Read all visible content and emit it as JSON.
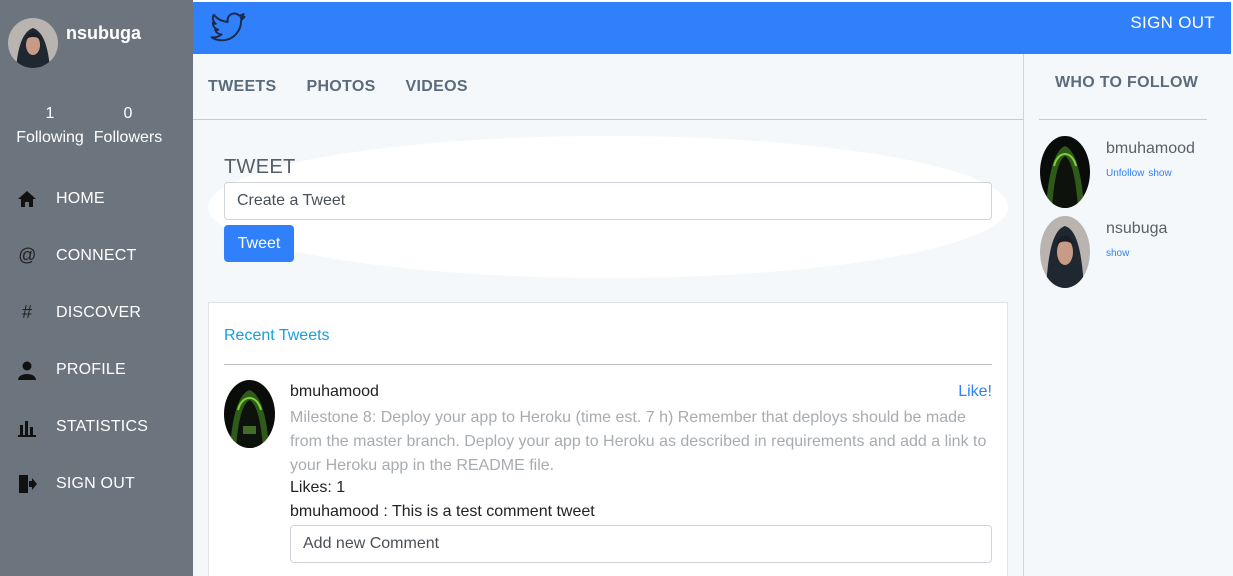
{
  "sidebar": {
    "username": "nsubuga",
    "following_count": "1",
    "following_label": "Following",
    "followers_count": "0",
    "followers_label": "Followers",
    "items": [
      {
        "label": "HOME",
        "icon": "home-icon"
      },
      {
        "label": "CONNECT",
        "icon": "at-icon"
      },
      {
        "label": "DISCOVER",
        "icon": "hash-icon"
      },
      {
        "label": "PROFILE",
        "icon": "user-icon"
      },
      {
        "label": "STATISTICS",
        "icon": "chart-icon"
      },
      {
        "label": "SIGN OUT",
        "icon": "sign-out-icon"
      }
    ]
  },
  "topbar": {
    "logo_icon": "twitter-bird-icon",
    "sign_out": "SIGN OUT",
    "color": "#2f80fa"
  },
  "tabs": [
    "TWEETS",
    "PHOTOS",
    "VIDEOS"
  ],
  "compose": {
    "title": "TWEET",
    "placeholder": "Create a Tweet",
    "button": "Tweet"
  },
  "feed": {
    "title": "Recent Tweets",
    "tweets": [
      {
        "user": "bmuhamood",
        "like": "Like!",
        "body": "Milestone 8: Deploy your app to Heroku (time est. 7 h) Remember that deploys should be made from the master branch. Deploy your app to Heroku as described in requirements and add a link to your Heroku app in the README file.",
        "likes": "Likes: 1",
        "comment": "bmuhamood : This is a test comment tweet",
        "comment_placeholder": "Add new Comment"
      }
    ]
  },
  "who_to_follow": {
    "title": "WHO TO FOLLOW",
    "users": [
      {
        "name": "bmuhamood",
        "unfollow": "Unfollow",
        "show": "show"
      },
      {
        "name": "nsubuga",
        "show": "show"
      }
    ]
  }
}
